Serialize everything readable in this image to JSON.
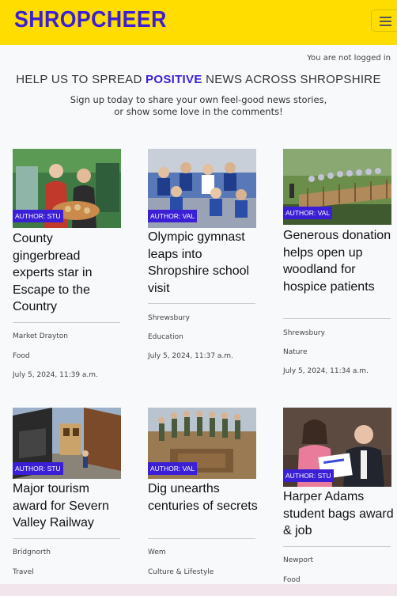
{
  "brand": "SHROPCHEER",
  "nav": {
    "toggler_icon": "hamburger-menu-icon"
  },
  "login_status": "You are not logged in",
  "hero": {
    "title_before": "HELP US TO SPREAD ",
    "title_highlight": "POSITIVE",
    "title_after": " NEWS ACROSS SHROPSHIRE",
    "subtitle_line1": "Sign up today to share your own feel-good news stories,",
    "subtitle_line2": "or show some love in the comments!"
  },
  "colors": {
    "navbar": "#ffdd00",
    "accent": "#3b1fd6"
  },
  "posts": [
    {
      "author": "AUTHOR: STU",
      "title": "County gingerbread experts star in Escape to the Country",
      "location": "Market Drayton",
      "category": "Food",
      "date": "July 5, 2024, 11:39 a.m."
    },
    {
      "author": "AUTHOR: VAL",
      "title": "Olympic gymnast leaps into Shropshire school visit",
      "location": "Shrewsbury",
      "category": "Education",
      "date": "July 5, 2024, 11:37 a.m."
    },
    {
      "author": "AUTHOR: VAL",
      "title": "Generous donation helps open up woodland for hospice patients",
      "location": "Shrewsbury",
      "category": "Nature",
      "date": "July 5, 2024, 11:34 a.m."
    },
    {
      "author": "AUTHOR: STU",
      "title": "Major tourism award for Severn Valley Railway",
      "location": "Bridgnorth",
      "category": "Travel",
      "date": ""
    },
    {
      "author": "AUTHOR: VAL",
      "title": "Dig unearths centuries of secrets",
      "location": "Wem",
      "category": "Culture & Lifestyle",
      "date": ""
    },
    {
      "author": "AUTHOR: STU",
      "title": "Harper Adams student bags award & job",
      "location": "Newport",
      "category": "Food",
      "date": ""
    }
  ]
}
